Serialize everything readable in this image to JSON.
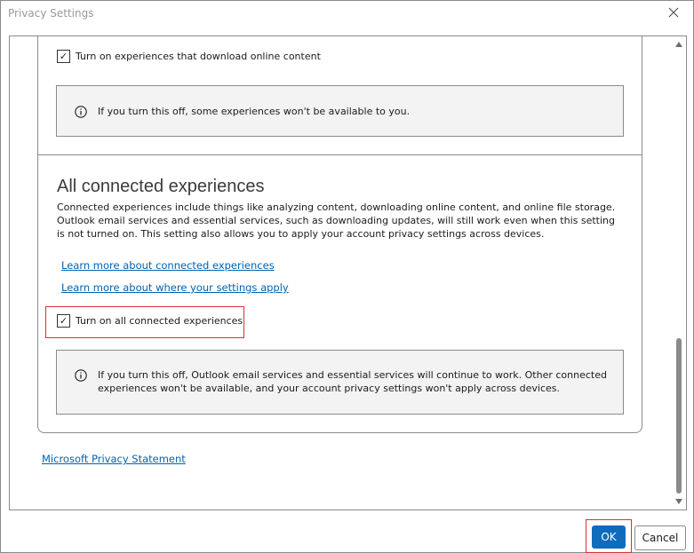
{
  "window": {
    "title": "Privacy Settings"
  },
  "section_download": {
    "checkbox_label": "Turn on experiences that download online content",
    "checked": true,
    "info_text": "If you turn this off, some experiences won't be available to you."
  },
  "section_connected": {
    "heading": "All connected experiences",
    "description": "Connected experiences include things like analyzing content, downloading online content, and online file storage. Outlook email services and essential services, such as downloading updates, will still work even when this setting is not turned on. This setting also allows you to apply your account privacy settings across devices.",
    "link_learn_more": "Learn more about connected experiences",
    "link_where_apply": "Learn more about where your settings apply",
    "checkbox_label": "Turn on all connected experiences",
    "checked": true,
    "info_line1": "If you turn this off, Outlook email services and essential services will continue to work. Other connected",
    "info_line2": "experiences won't be available, and your account privacy settings won't apply across devices."
  },
  "privacy_statement_link": "Microsoft Privacy Statement",
  "buttons": {
    "ok": "OK",
    "cancel": "Cancel"
  },
  "icons": {
    "checkmark": "✓",
    "info": "info-icon",
    "close": "close-icon"
  },
  "colors": {
    "accent": "#0f6cbd",
    "link": "#0063b1",
    "highlight": "#d13438"
  }
}
